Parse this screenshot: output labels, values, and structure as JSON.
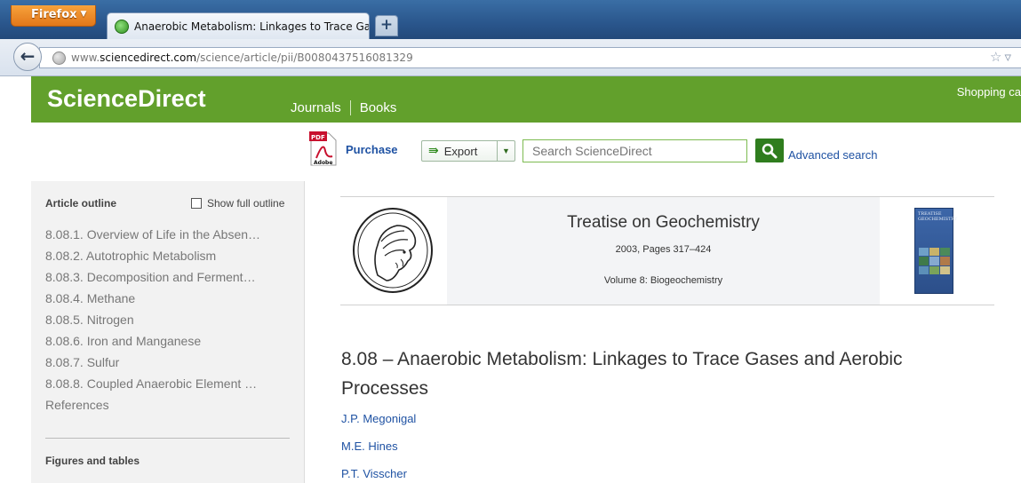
{
  "browser": {
    "menu_button": "Firefox",
    "tab_title": "Anaerobic Metabolism: Linkages to Trace Ga...",
    "new_tab_label": "+",
    "url_prefix": "www.",
    "url_domain": "sciencedirect.com",
    "url_path": "/science/article/pii/B0080437516081329"
  },
  "header": {
    "logo": "ScienceDirect",
    "nav": [
      "Journals",
      "Books"
    ],
    "shopping_cart": "Shopping ca"
  },
  "toolbar": {
    "purchase": "Purchase",
    "export": "Export",
    "search_placeholder": "Search ScienceDirect",
    "advanced_search": "Advanced search"
  },
  "sidebar": {
    "outline_title": "Article outline",
    "show_full_outline": "Show full outline",
    "items": [
      "8.08.1. Overview of Life in the Absen…",
      "8.08.2. Autotrophic Metabolism",
      "8.08.3. Decomposition and Ferment…",
      "8.08.4. Methane",
      "8.08.5. Nitrogen",
      "8.08.6. Iron and Manganese",
      "8.08.7. Sulfur",
      "8.08.8. Coupled Anaerobic Element …",
      "References"
    ],
    "figures_title": "Figures and tables"
  },
  "journal": {
    "title": "Treatise on Geochemistry",
    "pages": "2003, Pages 317–424",
    "volume": "Volume 8: Biogeochemistry",
    "cover_title": "TREATISE GEOCHEMISTRY"
  },
  "article": {
    "title": "8.08 – Anaerobic Metabolism: Linkages to Trace Gases and Aerobic Processes",
    "authors": [
      "J.P. Megonigal",
      "M.E. Hines",
      "P.T. Visscher"
    ]
  },
  "colors": {
    "brand_green": "#62a02c",
    "link_blue": "#1f52a3",
    "firefox_orange": "#e2771a"
  }
}
